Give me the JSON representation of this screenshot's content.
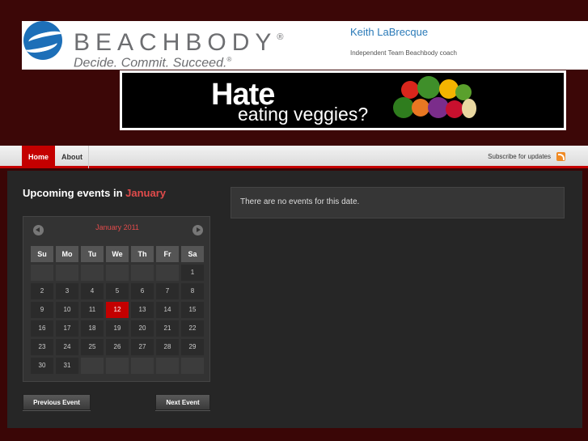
{
  "header": {
    "brand": "BEACHBODY",
    "brand_mark": "®",
    "tagline": "Decide. Commit. Succeed.",
    "tagline_mark": "®",
    "coach_name": "Keith LaBrecque",
    "coach_title": "Independent Team Beachbody coach"
  },
  "banner": {
    "line1": "Hate",
    "line2": "eating veggies?"
  },
  "nav": {
    "items": [
      {
        "label": "Home",
        "active": true
      },
      {
        "label": "About",
        "active": false
      }
    ],
    "subscribe": "Subscribe for updates"
  },
  "events": {
    "heading_prefix": "Upcoming events in",
    "heading_month": "January",
    "no_events": "There are no events for this date.",
    "prev_button": "Previous Event",
    "next_button": "Next Event"
  },
  "calendar": {
    "title": "January 2011",
    "weekdays": [
      "Su",
      "Mo",
      "Tu",
      "We",
      "Th",
      "Fr",
      "Sa"
    ],
    "leading_blanks": 6,
    "days_in_month": 31,
    "today": 12
  },
  "colors": {
    "accent": "#c40000",
    "background": "#3a0606",
    "panel": "#262626"
  }
}
